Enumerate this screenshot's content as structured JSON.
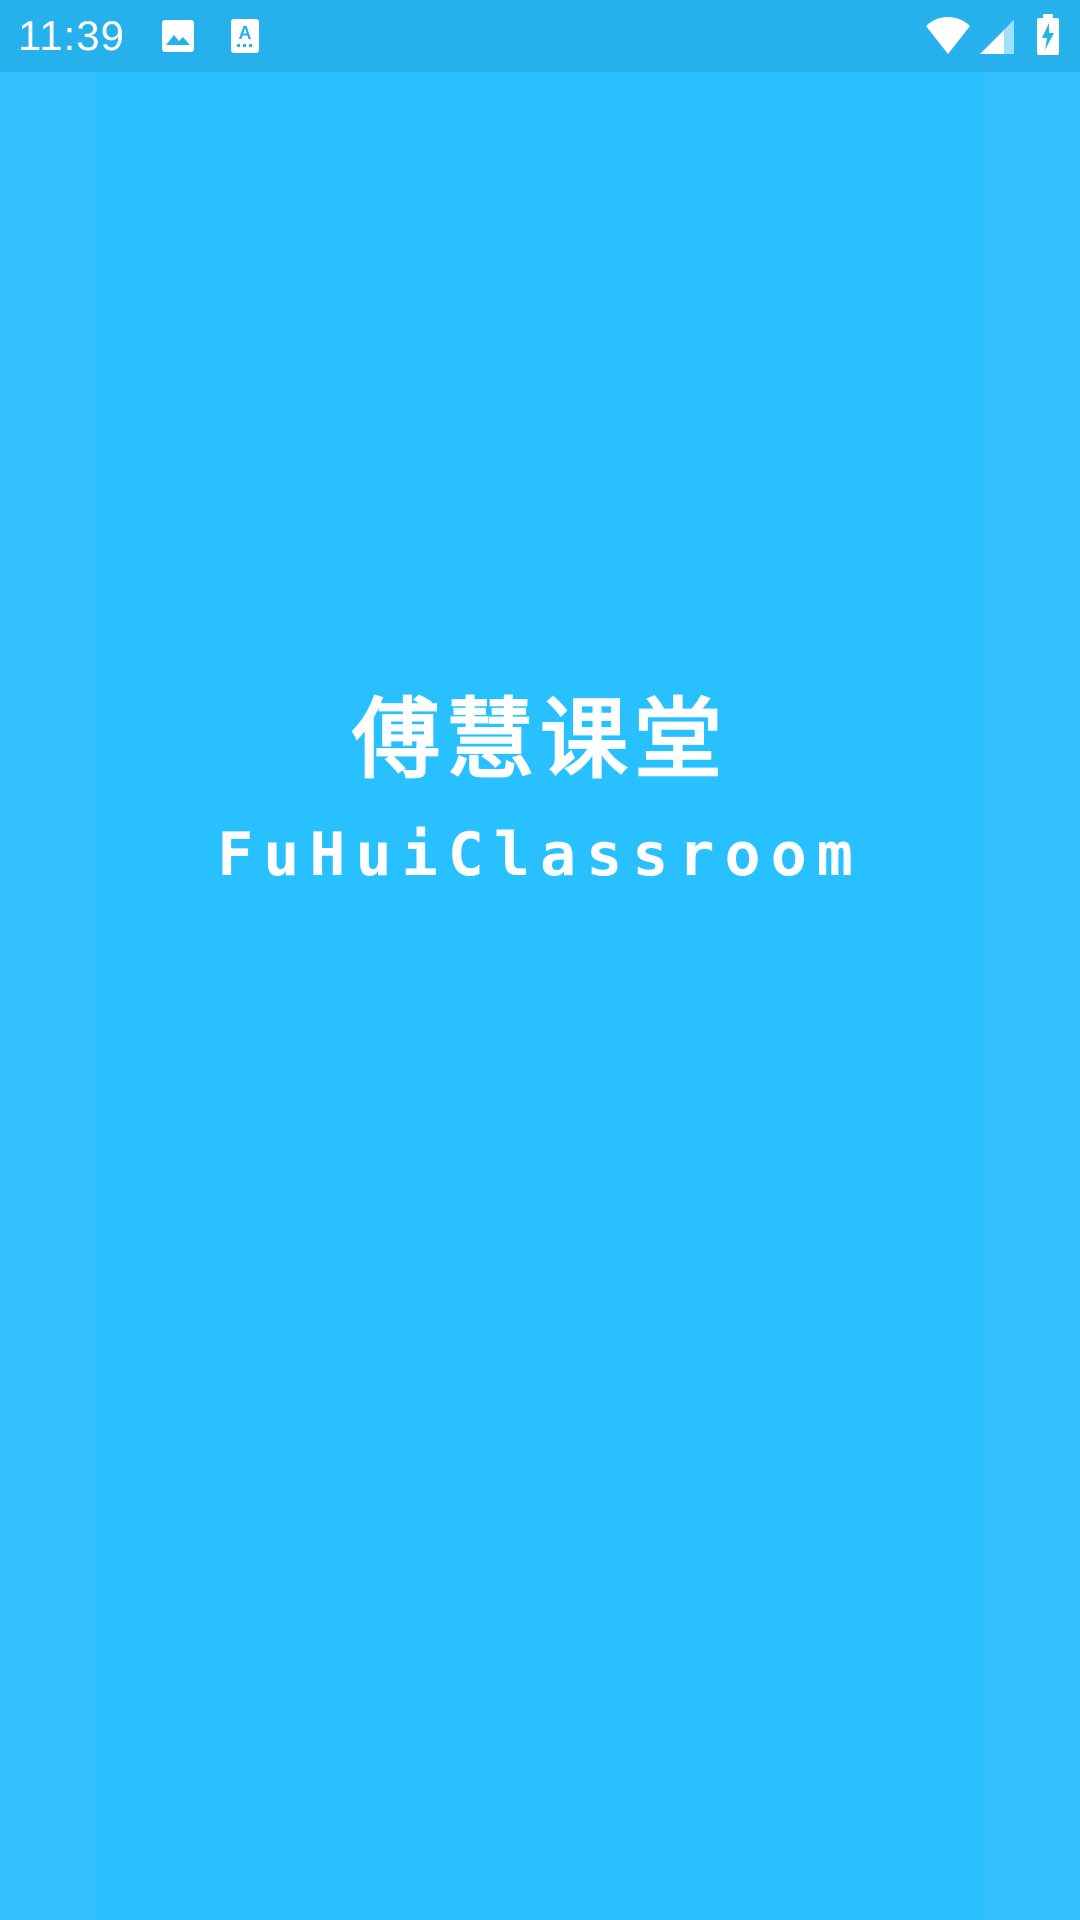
{
  "status_bar": {
    "time": "11:39",
    "left_icons": [
      "image-notification-icon",
      "keyboard-a-icon"
    ],
    "right_icons": [
      "wifi-icon",
      "cellular-signal-icon",
      "battery-charging-icon"
    ]
  },
  "splash": {
    "title": "傅慧课堂",
    "subtitle": "FuHuiClassroom"
  },
  "colors": {
    "background": "#29c0ff",
    "status_bar": "#27b1ec",
    "text": "#ffffff"
  }
}
